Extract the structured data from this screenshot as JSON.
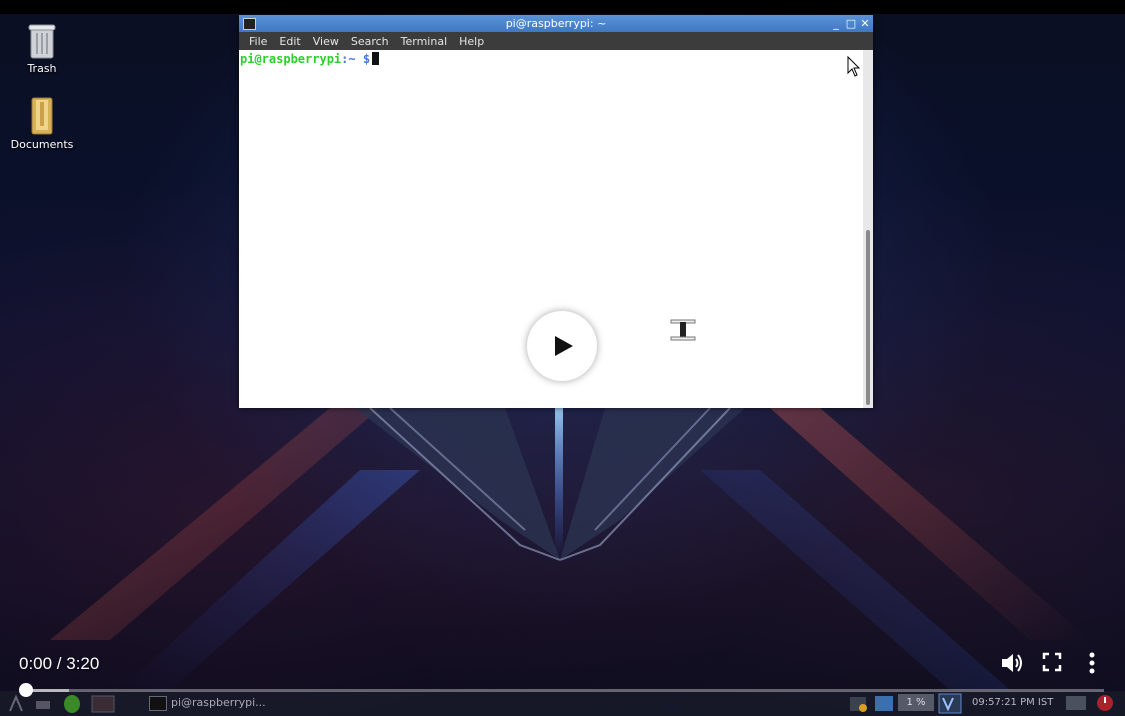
{
  "desktop": {
    "icons": [
      {
        "label": "Trash",
        "icon": "trash-icon"
      },
      {
        "label": "Documents",
        "icon": "folder-icon"
      }
    ]
  },
  "terminal": {
    "title": "pi@raspberrypi: ~",
    "menu": [
      "File",
      "Edit",
      "View",
      "Search",
      "Terminal",
      "Help"
    ],
    "prompt_user": "pi@raspberrypi",
    "prompt_sep": ":~ $",
    "window_controls": {
      "minimize": "_",
      "maximize": "□",
      "close": "✕"
    }
  },
  "video": {
    "time": "0:00 / 3:20",
    "progress_fraction": 0.0,
    "buffered_fraction": 0.04,
    "icons": {
      "play": "play-icon",
      "volume": "volume-icon",
      "fullscreen": "fullscreen-icon",
      "more": "more-options-icon"
    }
  },
  "taskbar": {
    "task_label": "pi@raspberrypi...",
    "cpu": "1 %",
    "clock": "09:57:21 PM IST"
  },
  "colors": {
    "titlebar": "#4a86cf",
    "prompt_user": "#2bd02b",
    "prompt_sep": "#4a78d8",
    "menubar": "#3c3c3c"
  }
}
